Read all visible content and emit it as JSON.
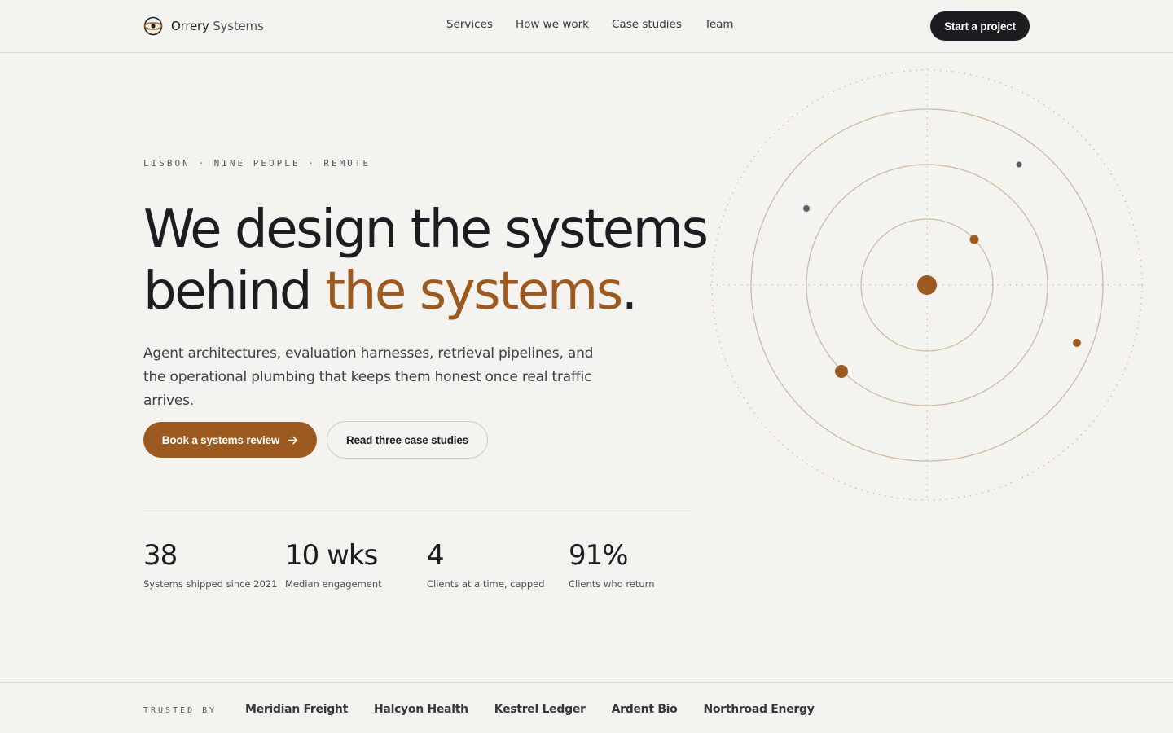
{
  "brand": {
    "name_primary": "Orrery",
    "name_secondary": "Systems",
    "icon": "orrery-eye-icon",
    "accent_color": "#9c5a20"
  },
  "nav": {
    "items": [
      "Services",
      "How we work",
      "Case studies",
      "Team"
    ],
    "cta_label": "Start a project"
  },
  "hero": {
    "eyebrow": "LISBON · NINE PEOPLE · REMOTE",
    "headline_line1": "We design the systems",
    "headline_line2_plain": "behind ",
    "headline_line2_accent": "the systems",
    "headline_line2_end": ".",
    "lede": "Agent architectures, evaluation harnesses, retrieval pipelines, and the operational plumbing that keeps them honest once real traffic arrives.",
    "primary_button": "Book a systems review",
    "primary_button_icon": "arrow-right-icon",
    "secondary_button": "Read three case studies"
  },
  "stats": [
    {
      "value": "38",
      "label": "Systems shipped since 2021"
    },
    {
      "value": "10 wks",
      "label": "Median engagement"
    },
    {
      "value": "4",
      "label": "Clients at a time, capped"
    },
    {
      "value": "91%",
      "label": "Clients who return"
    }
  ],
  "trust": {
    "label": "TRUSTED BY",
    "clients": [
      "Meridian Freight",
      "Halcyon Health",
      "Kestrel Ledger",
      "Ardent Bio",
      "Northroad Energy"
    ]
  },
  "colors": {
    "background": "#f5f3f0",
    "ink": "#1c1d20",
    "accent": "#9c5a20",
    "orbit_line": "#cdb9a6",
    "planet_grey": "#5b5f66"
  }
}
